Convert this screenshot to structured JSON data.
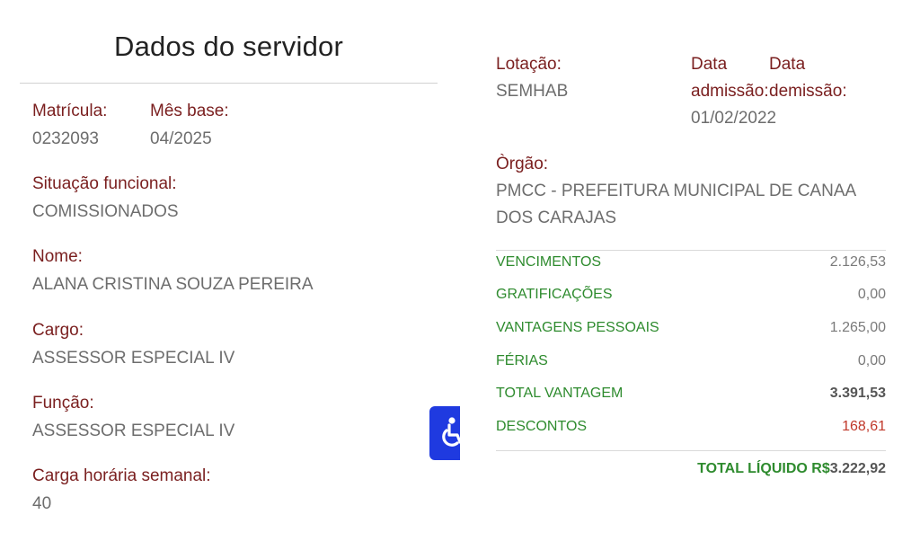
{
  "left": {
    "title": "Dados do servidor",
    "matricula": {
      "label": "Matrícula:",
      "value": "0232093"
    },
    "mes_base": {
      "label": "Mês base:",
      "value": "04/2025"
    },
    "situacao": {
      "label": "Situação funcional:",
      "value": "COMISSIONADOS"
    },
    "nome": {
      "label": "Nome:",
      "value": "ALANA CRISTINA SOUZA PEREIRA"
    },
    "cargo": {
      "label": "Cargo:",
      "value": "ASSESSOR ESPECIAL IV"
    },
    "funcao": {
      "label": "Função:",
      "value": "ASSESSOR ESPECIAL IV"
    },
    "carga": {
      "label": "Carga horária semanal:",
      "value": "40"
    },
    "accessibility_icon": "wheelchair-icon",
    "accessibility_color": "#1f3ae0"
  },
  "right": {
    "lotacao": {
      "label": "Lotação:",
      "value": "SEMHAB"
    },
    "data_admissao": {
      "label_line1": "Data",
      "label_line2": "admissão:",
      "value": "01/02/2022"
    },
    "data_demissao": {
      "label_line1": "Data",
      "label_line2": "demissão:"
    },
    "orgao": {
      "label": "Òrgão:",
      "value_line1": "PMCC - PREFEITURA MUNICIPAL DE CANAA",
      "value_line2": "DOS CARAJAS"
    },
    "summary": {
      "vencimentos": {
        "label": "VENCIMENTOS",
        "value": "2.126,53"
      },
      "gratificacoes": {
        "label": "GRATIFICAÇÕES",
        "value": "0,00"
      },
      "vantagens_pessoais": {
        "label": "VANTAGENS PESSOAIS",
        "value": "1.265,00"
      },
      "ferias": {
        "label": "FÉRIAS",
        "value": "0,00"
      },
      "total_vantagem": {
        "label": "TOTAL VANTAGEM",
        "value": "3.391,53"
      },
      "descontos": {
        "label": "DESCONTOS",
        "value": "168,61"
      }
    },
    "total_liquido": {
      "label": "TOTAL LÍQUIDO R$",
      "value": "3.222,92"
    }
  },
  "colors": {
    "label": "#7a1f1f",
    "value": "#6d6d6d",
    "summary_label": "#2e8b2e",
    "descontos": "#c0392b"
  }
}
